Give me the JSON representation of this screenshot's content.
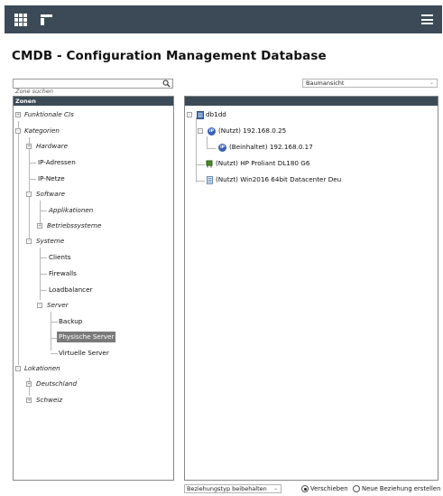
{
  "app": {
    "title": "CMDB - Configuration Management Database"
  },
  "search": {
    "placeholder": "Zone suchen"
  },
  "view_select": {
    "value": "Baumansicht"
  },
  "left_panel": {
    "header": "Zonen",
    "tree": [
      {
        "label": "Funktionale CIs",
        "style": "category",
        "level": 0,
        "toggle": "+"
      },
      {
        "label": "Kategorien",
        "style": "category",
        "level": 0,
        "toggle": "-"
      },
      {
        "label": "Hardware",
        "style": "category",
        "level": 1,
        "toggle": "+"
      },
      {
        "label": "IP-Adressen",
        "style": "leaf",
        "level": 1
      },
      {
        "label": "IP-Netze",
        "style": "leaf",
        "level": 1
      },
      {
        "label": "Software",
        "style": "category",
        "level": 1,
        "toggle": "-"
      },
      {
        "label": "Applikationen",
        "style": "category",
        "level": 2
      },
      {
        "label": "Betriebssysteme",
        "style": "category",
        "level": 2,
        "toggle": "+"
      },
      {
        "label": "Systeme",
        "style": "category",
        "level": 1,
        "toggle": "-"
      },
      {
        "label": "Clients",
        "style": "leaf",
        "level": 2
      },
      {
        "label": "Firewalls",
        "style": "leaf",
        "level": 2
      },
      {
        "label": "Loadbalancer",
        "style": "leaf",
        "level": 2
      },
      {
        "label": "Server",
        "style": "category",
        "level": 2,
        "toggle": "-"
      },
      {
        "label": "Backup",
        "style": "leaf",
        "level": 3
      },
      {
        "label": "Physische Server",
        "style": "leaf",
        "level": 3,
        "selected": true
      },
      {
        "label": "Virtuelle Server",
        "style": "leaf",
        "level": 3
      },
      {
        "label": "Lokationen",
        "style": "category",
        "level": 0,
        "toggle": "-"
      },
      {
        "label": "Deutschland",
        "style": "category",
        "level": 1,
        "toggle": "+"
      },
      {
        "label": "Schweiz",
        "style": "category",
        "level": 1,
        "toggle": "+"
      }
    ]
  },
  "right_panel": {
    "root": "db1dd",
    "relations": [
      {
        "label": "(Nutzt) 192.168.0.25",
        "icon": "ip-icon"
      },
      {
        "label": "(Beinhaltet) 192.168.0.17",
        "icon": "ip-icon"
      },
      {
        "label": "(Nutzt) HP Proliant DL180 G6",
        "icon": "hardware-icon"
      },
      {
        "label": "(Nutzt) Win2016 64bit Datacenter Deu",
        "icon": "os-icon"
      }
    ],
    "ip_icon_text": "IP"
  },
  "bottom": {
    "relation_select": "Beziehungstyp beibehalten",
    "radio_move": "Verschieben",
    "radio_new": "Neue Beziehung erstellen",
    "radio_selected": "Verschieben"
  },
  "colors": {
    "topbar": "#3b4a56",
    "selected_bg": "#7a7a7a",
    "ip_icon": "#3a63b5"
  }
}
